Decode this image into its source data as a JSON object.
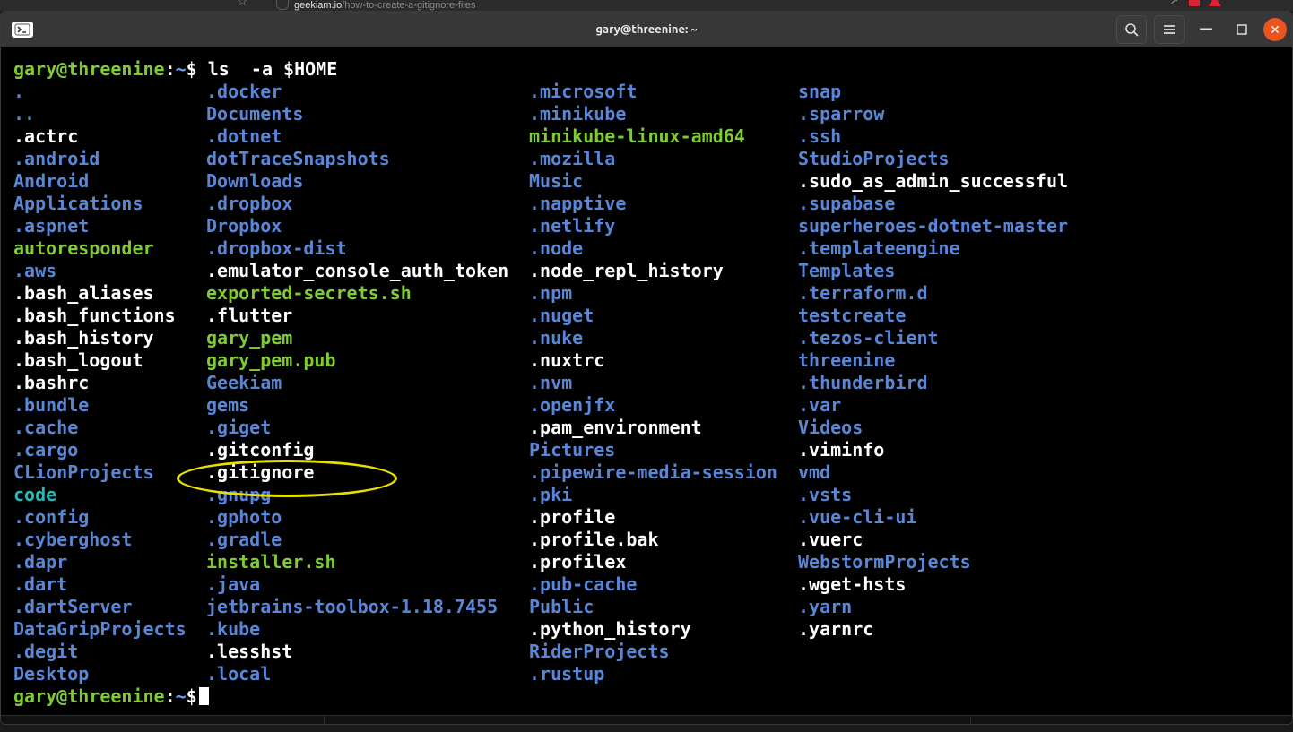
{
  "browser": {
    "url_host": "geekiam.io",
    "url_path": "/how-to-create-a-gitignore-files"
  },
  "window": {
    "title": "gary@threenine: ~"
  },
  "prompt": {
    "user_host": "gary@threenine",
    "sep": ":",
    "path": "~",
    "symbol": "$",
    "command": "ls  -a $HOME"
  },
  "listing": {
    "cols": [
      [
        {
          "t": ".",
          "c": "dir"
        },
        {
          "t": "..",
          "c": "dir"
        },
        {
          "t": ".actrc",
          "c": "file"
        },
        {
          "t": ".android",
          "c": "dir"
        },
        {
          "t": "Android",
          "c": "dir"
        },
        {
          "t": "Applications",
          "c": "dir"
        },
        {
          "t": ".aspnet",
          "c": "dir"
        },
        {
          "t": "autoresponder",
          "c": "exec"
        },
        {
          "t": ".aws",
          "c": "dir"
        },
        {
          "t": ".bash_aliases",
          "c": "file"
        },
        {
          "t": ".bash_functions",
          "c": "file"
        },
        {
          "t": ".bash_history",
          "c": "file"
        },
        {
          "t": ".bash_logout",
          "c": "file"
        },
        {
          "t": ".bashrc",
          "c": "file"
        },
        {
          "t": ".bundle",
          "c": "dir"
        },
        {
          "t": ".cache",
          "c": "dir"
        },
        {
          "t": ".cargo",
          "c": "dir"
        },
        {
          "t": "CLionProjects",
          "c": "dir"
        },
        {
          "t": "code",
          "c": "link"
        },
        {
          "t": ".config",
          "c": "dir"
        },
        {
          "t": ".cyberghost",
          "c": "dir"
        },
        {
          "t": ".dapr",
          "c": "dir"
        },
        {
          "t": ".dart",
          "c": "dir"
        },
        {
          "t": ".dartServer",
          "c": "dir"
        },
        {
          "t": "DataGripProjects",
          "c": "dir"
        },
        {
          "t": ".degit",
          "c": "dir"
        },
        {
          "t": "Desktop",
          "c": "dir"
        }
      ],
      [
        {
          "t": ".docker",
          "c": "dir"
        },
        {
          "t": "Documents",
          "c": "dir"
        },
        {
          "t": ".dotnet",
          "c": "dir"
        },
        {
          "t": "dotTraceSnapshots",
          "c": "dir"
        },
        {
          "t": "Downloads",
          "c": "dir"
        },
        {
          "t": ".dropbox",
          "c": "dir"
        },
        {
          "t": "Dropbox",
          "c": "dir"
        },
        {
          "t": ".dropbox-dist",
          "c": "dir"
        },
        {
          "t": ".emulator_console_auth_token",
          "c": "file"
        },
        {
          "t": "exported-secrets.sh",
          "c": "exec"
        },
        {
          "t": ".flutter",
          "c": "file"
        },
        {
          "t": "gary_pem",
          "c": "exec"
        },
        {
          "t": "gary_pem.pub",
          "c": "exec"
        },
        {
          "t": "Geekiam",
          "c": "dir"
        },
        {
          "t": "gems",
          "c": "dir"
        },
        {
          "t": ".giget",
          "c": "dir"
        },
        {
          "t": ".gitconfig",
          "c": "file"
        },
        {
          "t": ".gitignore",
          "c": "file"
        },
        {
          "t": ".gnupg",
          "c": "dir"
        },
        {
          "t": ".gphoto",
          "c": "dir"
        },
        {
          "t": ".gradle",
          "c": "dir"
        },
        {
          "t": "installer.sh",
          "c": "exec"
        },
        {
          "t": ".java",
          "c": "dir"
        },
        {
          "t": "jetbrains-toolbox-1.18.7455",
          "c": "dir"
        },
        {
          "t": ".kube",
          "c": "dir"
        },
        {
          "t": ".lesshst",
          "c": "file"
        },
        {
          "t": ".local",
          "c": "dir"
        }
      ],
      [
        {
          "t": ".microsoft",
          "c": "dir"
        },
        {
          "t": ".minikube",
          "c": "dir"
        },
        {
          "t": "minikube-linux-amd64",
          "c": "exec"
        },
        {
          "t": ".mozilla",
          "c": "dir"
        },
        {
          "t": "Music",
          "c": "dir"
        },
        {
          "t": ".napptive",
          "c": "dir"
        },
        {
          "t": ".netlify",
          "c": "dir"
        },
        {
          "t": ".node",
          "c": "dir"
        },
        {
          "t": ".node_repl_history",
          "c": "file"
        },
        {
          "t": ".npm",
          "c": "dir"
        },
        {
          "t": ".nuget",
          "c": "dir"
        },
        {
          "t": ".nuke",
          "c": "dir"
        },
        {
          "t": ".nuxtrc",
          "c": "file"
        },
        {
          "t": ".nvm",
          "c": "dir"
        },
        {
          "t": ".openjfx",
          "c": "dir"
        },
        {
          "t": ".pam_environment",
          "c": "file"
        },
        {
          "t": "Pictures",
          "c": "dir"
        },
        {
          "t": ".pipewire-media-session",
          "c": "dir"
        },
        {
          "t": ".pki",
          "c": "dir"
        },
        {
          "t": ".profile",
          "c": "file"
        },
        {
          "t": ".profile.bak",
          "c": "file"
        },
        {
          "t": ".profilex",
          "c": "file"
        },
        {
          "t": ".pub-cache",
          "c": "dir"
        },
        {
          "t": "Public",
          "c": "dir"
        },
        {
          "t": ".python_history",
          "c": "file"
        },
        {
          "t": "RiderProjects",
          "c": "dir"
        },
        {
          "t": ".rustup",
          "c": "dir"
        }
      ],
      [
        {
          "t": "snap",
          "c": "dir"
        },
        {
          "t": ".sparrow",
          "c": "dir"
        },
        {
          "t": ".ssh",
          "c": "dir"
        },
        {
          "t": "StudioProjects",
          "c": "dir"
        },
        {
          "t": ".sudo_as_admin_successful",
          "c": "file"
        },
        {
          "t": ".supabase",
          "c": "dir"
        },
        {
          "t": "superheroes-dotnet-master",
          "c": "dir"
        },
        {
          "t": ".templateengine",
          "c": "dir"
        },
        {
          "t": "Templates",
          "c": "dir"
        },
        {
          "t": ".terraform.d",
          "c": "dir"
        },
        {
          "t": "testcreate",
          "c": "dir"
        },
        {
          "t": ".tezos-client",
          "c": "dir"
        },
        {
          "t": "threenine",
          "c": "dir"
        },
        {
          "t": ".thunderbird",
          "c": "dir"
        },
        {
          "t": ".var",
          "c": "dir"
        },
        {
          "t": "Videos",
          "c": "dir"
        },
        {
          "t": ".viminfo",
          "c": "file"
        },
        {
          "t": "vmd",
          "c": "dir"
        },
        {
          "t": ".vsts",
          "c": "dir"
        },
        {
          "t": ".vue-cli-ui",
          "c": "dir"
        },
        {
          "t": ".vuerc",
          "c": "file"
        },
        {
          "t": "WebstormProjects",
          "c": "dir"
        },
        {
          "t": ".wget-hsts",
          "c": "file"
        },
        {
          "t": ".yarn",
          "c": "dir"
        },
        {
          "t": ".yarnrc",
          "c": "file"
        }
      ]
    ]
  },
  "annotation": {
    "highlighted_entry": ".gitignore"
  }
}
